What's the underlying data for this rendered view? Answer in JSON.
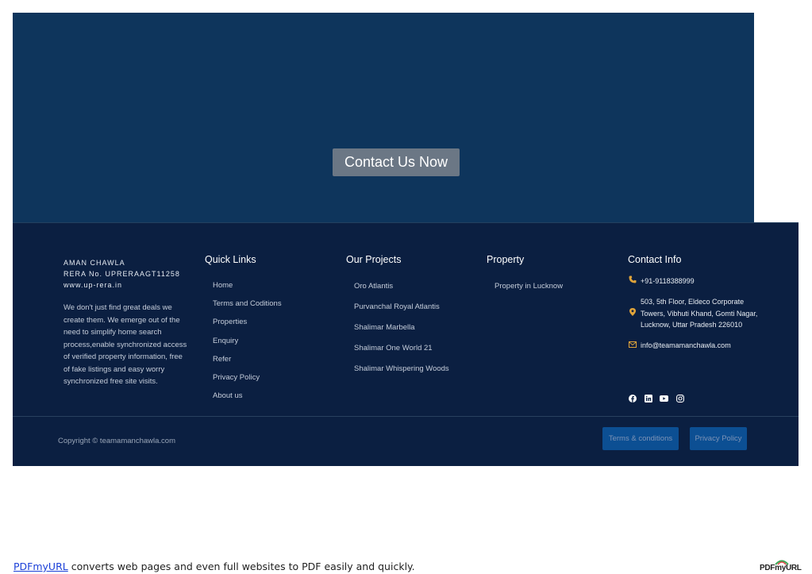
{
  "hero": {
    "cta_label": "Contact Us Now"
  },
  "footer": {
    "brand": {
      "name": "AMAN CHAWLA",
      "rera": "RERA No. UPRERAAGT11258",
      "website": "www.up-rera.in"
    },
    "about": "We don't just find great deals we create them. We emerge out of the need to simplify home search process,enable synchronized access of verified property information, free of fake listings and easy worry synchronized free site visits.",
    "quick_links": {
      "title": "Quick Links",
      "items": [
        "Home",
        "Terms and Coditions",
        "Properties",
        "Enquiry",
        "Refer",
        "Privacy Policy",
        "About us"
      ]
    },
    "projects": {
      "title": "Our Projects",
      "items": [
        "Oro Atlantis",
        "Purvanchal Royal Atlantis",
        "Shalimar Marbella",
        "Shalimar One World 21",
        "Shalimar Whispering Woods"
      ]
    },
    "property": {
      "title": "Property",
      "items": [
        "Property in Lucknow"
      ]
    },
    "contact": {
      "title": "Contact Info",
      "phone": "+91-9118388999",
      "address": [
        "503, 5th Floor, Eldeco Corporate",
        "Towers, Vibhuti Khand, Gomti Nagar,",
        "Lucknow, Uttar Pradesh 226010"
      ],
      "email": "info@teamamanchawla.com",
      "socials": [
        "facebook-icon",
        "linkedin-icon",
        "youtube-icon",
        "instagram-icon"
      ],
      "icon_color": "#e0a43a"
    },
    "copyright": "Copyright © teamamanchawla.com",
    "terms_button": "Terms & conditions",
    "privacy_button": "Privacy Policy"
  },
  "bottom_note": {
    "link": "PDFmyURL",
    "text": " converts web pages and even full websites to PDF easily and quickly."
  },
  "logo_text": "PDFmyURL",
  "colors": {
    "hero_bg": "#0e355c",
    "footer_bg": "#0b1f41",
    "button_bg": "#0c4f93",
    "cta_bg": "#6b7785"
  }
}
